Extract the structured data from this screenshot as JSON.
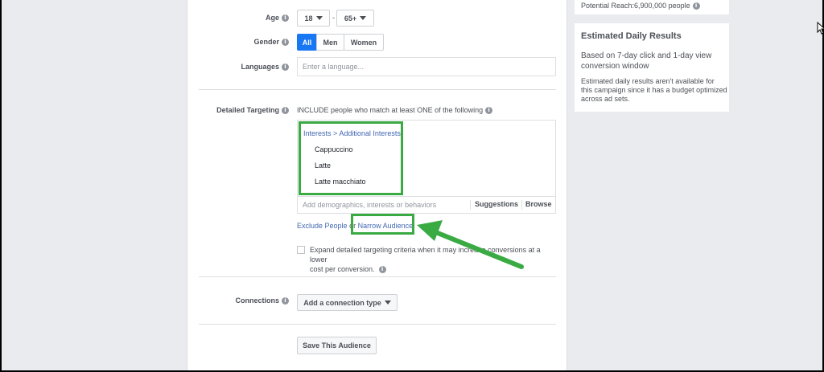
{
  "age": {
    "label": "Age",
    "min": "18",
    "max": "65+",
    "dash": "-"
  },
  "gender": {
    "label": "Gender",
    "options": [
      "All",
      "Men",
      "Women"
    ],
    "selected": "All"
  },
  "languages": {
    "label": "Languages",
    "placeholder": "Enter a language..."
  },
  "detailed_targeting": {
    "label": "Detailed Targeting",
    "description": "INCLUDE people who match at least ONE of the following",
    "breadcrumb": {
      "part1": "Interests",
      "sep": ">",
      "part2": "Additional Interests"
    },
    "items": [
      "Cappuccino",
      "Latte",
      "Latte macchiato"
    ],
    "input_placeholder": "Add demographics, interests or behaviors",
    "suggestions_label": "Suggestions",
    "browse_label": "Browse",
    "exclude_label": "Exclude People",
    "or_text": "or",
    "narrow_label": "Narrow Audience",
    "expand_text_1": "Expand detailed targeting criteria when it may increase conversions at a lower",
    "expand_text_2": "cost per conversion."
  },
  "connections": {
    "label": "Connections",
    "button_label": "Add a connection type"
  },
  "save_button_label": "Save This Audience",
  "sidebar": {
    "potential_reach": "Potential Reach:6,900,000 people",
    "estimated": {
      "title": "Estimated Daily Results",
      "subtitle": "Based on 7-day click and 1-day view conversion window",
      "note": "Estimated daily results aren't available for this campaign since it has a budget optimized across ad sets."
    }
  },
  "colors": {
    "accent": "#4267b2",
    "highlight": "#3aaa43",
    "primary_button": "#1877f2"
  }
}
